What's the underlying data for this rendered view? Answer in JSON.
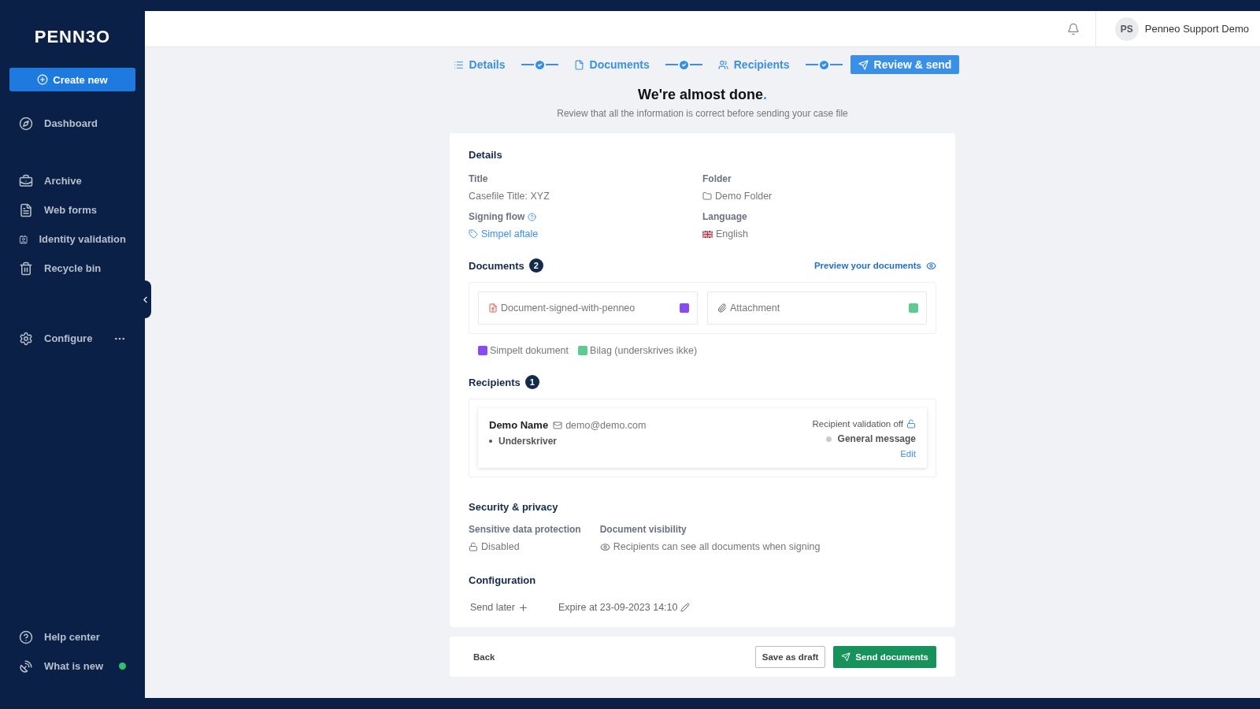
{
  "brand": "PENN3O",
  "create_button": "Create new",
  "sidebar": {
    "sections": [
      [
        {
          "label": "Dashboard",
          "new": false
        }
      ],
      [
        {
          "label": "Archive",
          "new": false
        },
        {
          "label": "Web forms",
          "new": false
        },
        {
          "label": "Identity validation",
          "new": false
        },
        {
          "label": "Recycle bin",
          "new": false
        }
      ],
      [
        {
          "label": "Configure",
          "new": false
        }
      ]
    ],
    "bottom_items": [
      {
        "label": "Help center",
        "new": false
      },
      {
        "label": "What is new",
        "new": true
      }
    ]
  },
  "user": {
    "initials": "PS",
    "name": "Penneo Support Demo"
  },
  "steps": [
    {
      "label": "Details",
      "selected": false
    },
    {
      "label": "Documents",
      "selected": false
    },
    {
      "label": "Recipients",
      "selected": false
    },
    {
      "label": "Review & send",
      "selected": true
    }
  ],
  "heading": "We're almost done",
  "heading_dot": ".",
  "subtitle": "Review that all the information is correct before sending your case file",
  "details": {
    "title": "Details",
    "fields": [
      {
        "label": "Title",
        "value": "Casefile Title: XYZ",
        "kind": "text"
      },
      {
        "label": "Folder",
        "value": "Demo Folder",
        "kind": "folder"
      },
      {
        "label": "Signing flow",
        "value": "Simpel aftale",
        "kind": "flow"
      },
      {
        "label": "Language",
        "value": "English",
        "kind": "language"
      }
    ]
  },
  "documents": {
    "title": "Documents",
    "count": "2",
    "preview": "Preview your documents",
    "items": [
      {
        "name": "Document-signed-with-penneo",
        "kind": "pdf",
        "color": "#8a4af3"
      },
      {
        "name": "Attachment",
        "kind": "attachment",
        "color": "#5ccb8f"
      }
    ],
    "legend": [
      {
        "label": "Simpelt dokument",
        "color": "#8a4af3"
      },
      {
        "label": "Bilag (underskrives ikke)",
        "color": "#5ccb8f"
      }
    ]
  },
  "recipients": {
    "title": "Recipients",
    "count": "1",
    "items": [
      {
        "name": "Demo Name",
        "email": "demo@demo.com",
        "role": "Underskriver",
        "validation": "Recipient validation off",
        "message": "General message",
        "edit": "Edit"
      }
    ]
  },
  "security": {
    "title": "Security & privacy",
    "fields": [
      {
        "label": "Sensitive data protection",
        "value": "Disabled",
        "kind": "lock"
      },
      {
        "label": "Document visibility",
        "value": "Recipients can see all documents when signing",
        "kind": "eye"
      }
    ]
  },
  "configuration": {
    "title": "Configuration",
    "send_later": "Send later",
    "expire": "Expire at 23-09-2023 14:10"
  },
  "footer": {
    "back": "Back",
    "draft": "Save as draft",
    "send": "Send documents"
  }
}
